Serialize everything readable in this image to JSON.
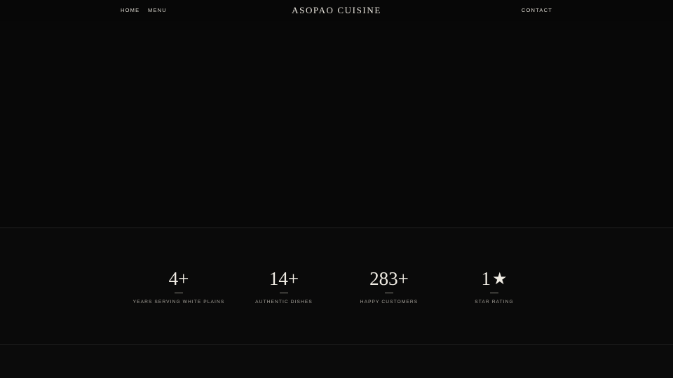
{
  "nav": {
    "home_label": "HOME",
    "menu_label": "MENU",
    "brand_title": "ASOPAO CUISINE",
    "contact_label": "CONTACT"
  },
  "stats": [
    {
      "value": "4+",
      "label": "YEARS SERVING WHITE PLAINS"
    },
    {
      "value": "14+",
      "label": "AUTHENTIC DISHES"
    },
    {
      "value": "283+",
      "label": "HAPPY CUSTOMERS"
    },
    {
      "value": "1",
      "icon": "star-icon",
      "glyph": "★",
      "label": "STAR RATING"
    }
  ],
  "colors": {
    "background": "#070707",
    "text": "#e8e4dc",
    "muted_text": "#a9a59d",
    "divider": "#1f1f1f"
  }
}
